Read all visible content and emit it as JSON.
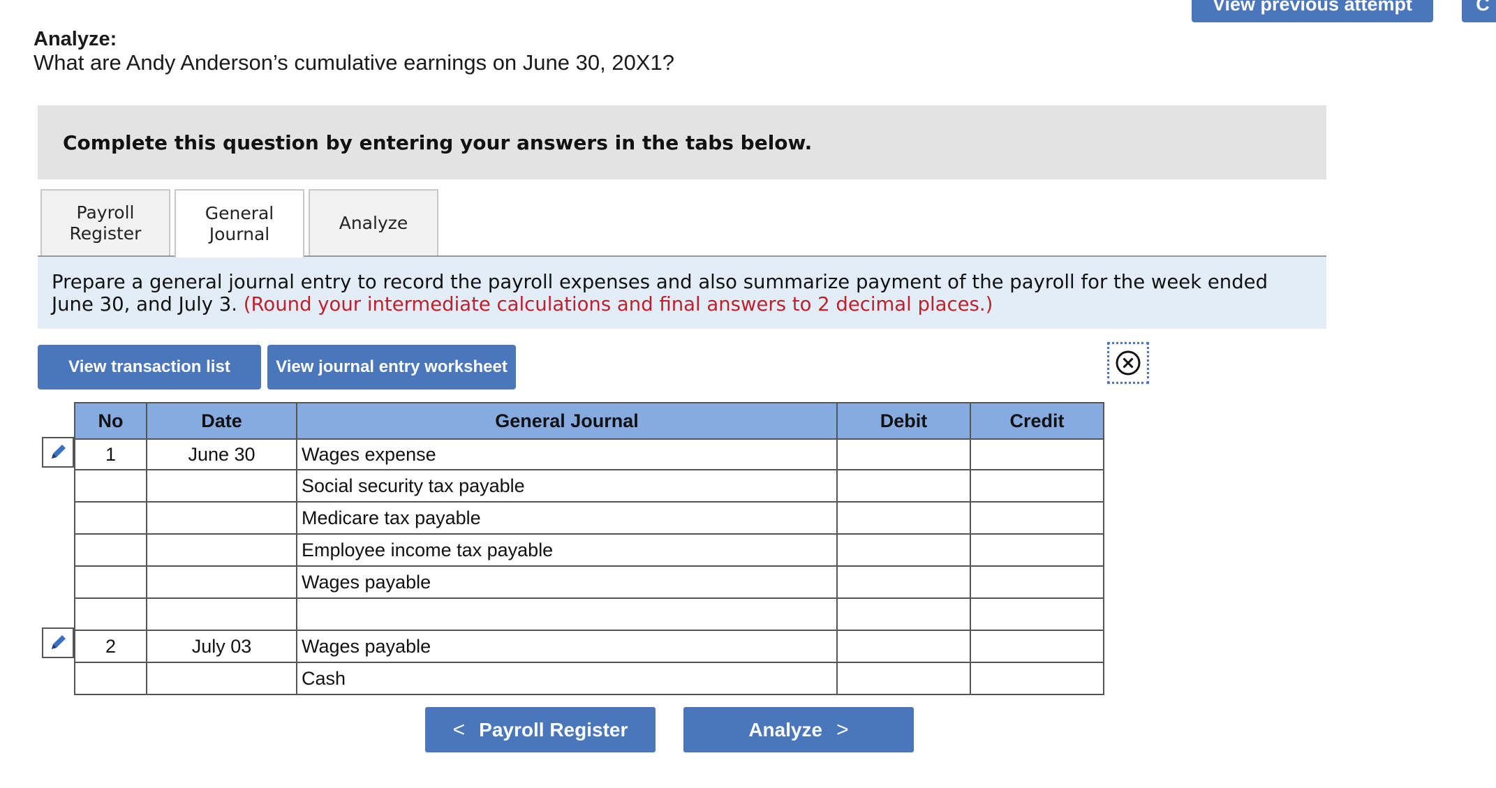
{
  "header": {
    "view_previous_attempt": "View previous attempt",
    "top_right_button": "C"
  },
  "section": {
    "label": "Analyze:",
    "question": "What are Andy Anderson’s cumulative earnings on June 30, 20X1?"
  },
  "instructions": "Complete this question by entering your answers in the tabs below.",
  "tabs": [
    {
      "label": "Payroll\nRegister",
      "active": false
    },
    {
      "label": "General\nJournal",
      "active": true
    },
    {
      "label": "Analyze",
      "active": false
    }
  ],
  "prompt": {
    "text": "Prepare a general journal entry to record the payroll expenses and also summarize payment of the payroll for the week ended June 30, and July 3.",
    "note": "(Round your intermediate calculations and final answers to 2 decimal places.)"
  },
  "buttons": {
    "view_transactions": "View transaction list",
    "view_worksheet": "View journal entry worksheet"
  },
  "journal": {
    "headers": [
      "No",
      "Date",
      "General Journal",
      "Debit",
      "Credit"
    ],
    "rows": [
      {
        "no": "1",
        "date": "June 30",
        "account": "Wages expense",
        "debit": "",
        "credit": ""
      },
      {
        "no": "",
        "date": "",
        "account": "Social security tax payable",
        "debit": "",
        "credit": ""
      },
      {
        "no": "",
        "date": "",
        "account": "Medicare tax payable",
        "debit": "",
        "credit": ""
      },
      {
        "no": "",
        "date": "",
        "account": "Employee income tax payable",
        "debit": "",
        "credit": ""
      },
      {
        "no": "",
        "date": "",
        "account": "Wages payable",
        "debit": "",
        "credit": ""
      },
      {
        "no": "",
        "date": "",
        "account": "",
        "debit": "",
        "credit": ""
      },
      {
        "no": "2",
        "date": "July 03",
        "account": "Wages payable",
        "debit": "",
        "credit": ""
      },
      {
        "no": "",
        "date": "",
        "account": "Cash",
        "debit": "",
        "credit": ""
      }
    ]
  },
  "nav": {
    "prev_label": "Payroll Register",
    "next_label": "Analyze"
  },
  "icons": {
    "close": "close-circle-icon",
    "edit": "pencil-icon"
  },
  "colors": {
    "button_blue": "#4a77bb",
    "table_header": "#86abe0",
    "prompt_bg": "#e2edf8",
    "note_red": "#c0202a"
  }
}
